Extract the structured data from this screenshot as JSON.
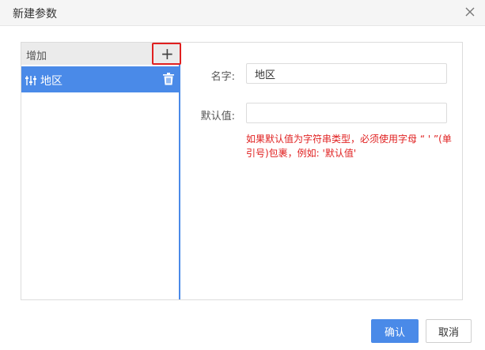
{
  "dialog": {
    "title": "新建参数",
    "close_icon": "close-icon"
  },
  "left_panel": {
    "header_label": "增加",
    "add_symbol": "+",
    "items": [
      {
        "label": "地区",
        "icon": "parameter-icon",
        "action_icon": "trash-icon"
      }
    ]
  },
  "form": {
    "name_label": "名字:",
    "name_value": "地区",
    "default_label": "默认值:",
    "default_value": "",
    "hint_lines": [
      "如果默认值为字符串类型，必须使用字母 “ ' ”(单",
      "引号)包裹，例如: '默认值'"
    ]
  },
  "footer": {
    "ok_label": "确认",
    "cancel_label": "取消"
  },
  "colors": {
    "accent": "#4a8ae8",
    "highlight_border": "#e02020",
    "hint_text": "#e02020"
  }
}
